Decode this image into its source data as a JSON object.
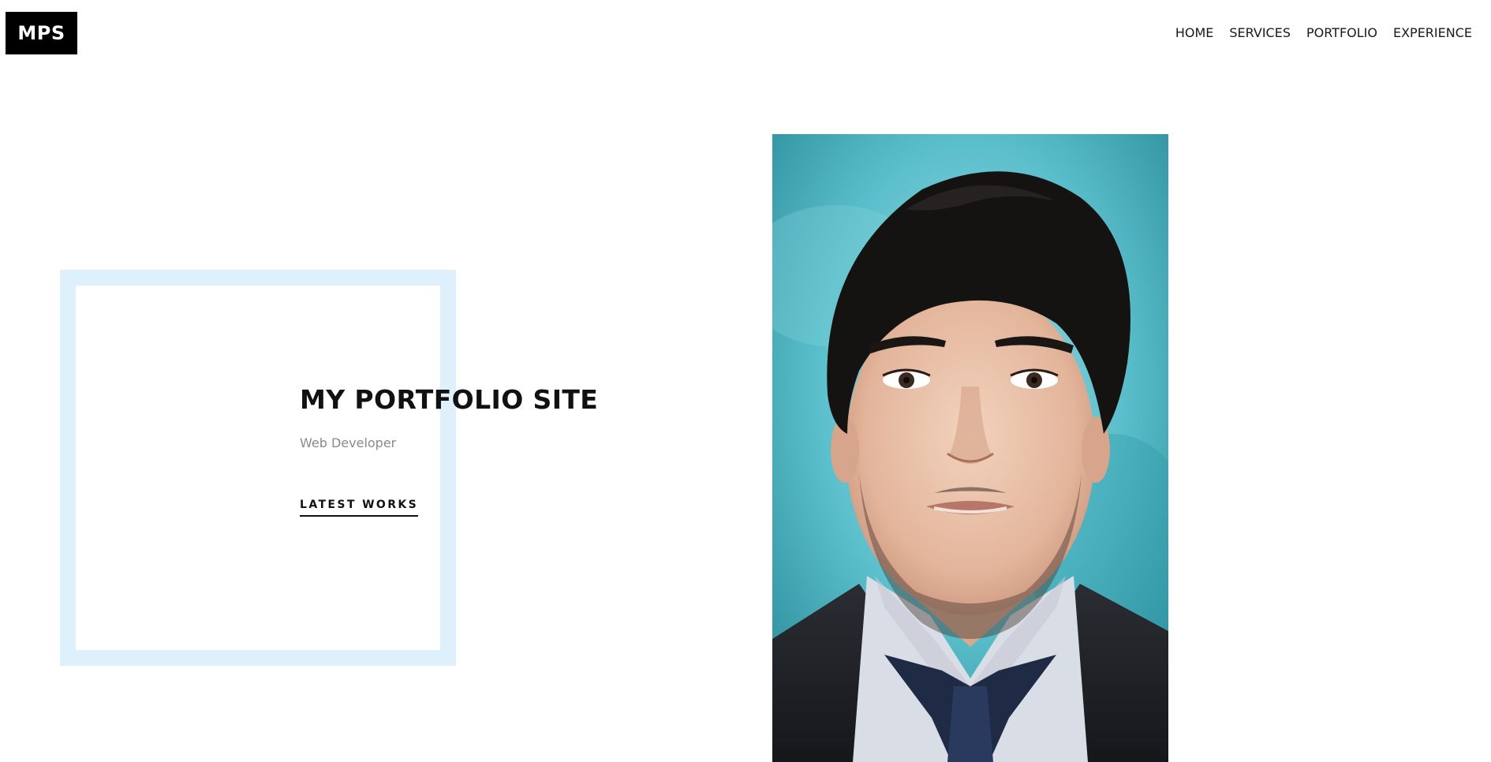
{
  "header": {
    "logo_text": "MPS",
    "nav": [
      {
        "label": "HOME"
      },
      {
        "label": "SERVICES"
      },
      {
        "label": "PORTFOLIO"
      },
      {
        "label": "EXPERIENCE"
      }
    ]
  },
  "hero": {
    "title": "MY PORTFOLIO SITE",
    "subtitle": "Web Developer",
    "cta_label": "LATEST WORKS"
  },
  "colors": {
    "frame": "#ddf0fc",
    "logo_bg": "#000000",
    "text_dark": "#111111",
    "text_muted": "#8a8a8a",
    "photo_background": "#4fb6c6"
  },
  "portrait": {
    "subject": "headshot of a man in a dark suit, white shirt and navy tie on a teal background"
  }
}
